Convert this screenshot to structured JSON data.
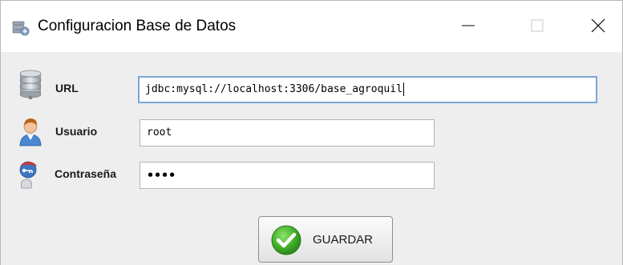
{
  "window": {
    "title": "Configuracion Base de Datos",
    "controls": {
      "minimize": "minimize-icon",
      "maximize": "maximize-icon",
      "close": "close-icon"
    }
  },
  "form": {
    "url": {
      "label": "URL",
      "value": "jdbc:mysql://localhost:3306/base_agroquil",
      "icon": "database-icon"
    },
    "usuario": {
      "label": "Usuario",
      "value": "root",
      "icon": "user-icon"
    },
    "contrasena": {
      "label": "Contraseña",
      "value": "••••",
      "icon": "user-key-icon"
    }
  },
  "actions": {
    "save_label": "GUARDAR",
    "save_icon": "check-icon"
  },
  "colors": {
    "content_bg": "#eeeeee",
    "focus_border": "#7aa7d6",
    "check_green": "#3fae2a"
  }
}
